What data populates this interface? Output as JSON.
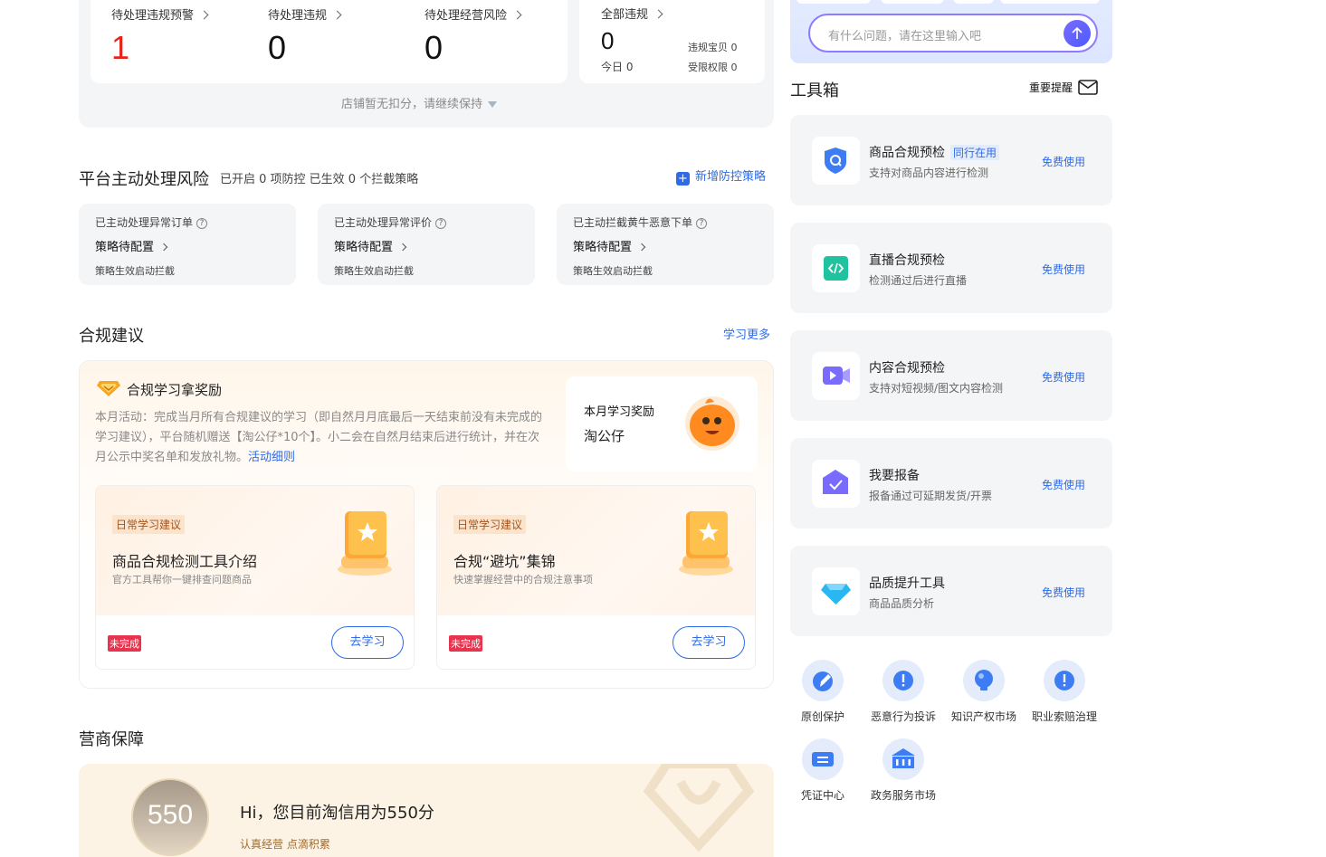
{
  "violations": {
    "items": [
      {
        "label": "待处理违规预警",
        "value": "1"
      },
      {
        "label": "待处理违规",
        "value": "0"
      },
      {
        "label": "待处理经营风险",
        "value": "0"
      }
    ],
    "all": {
      "label": "全部违规",
      "value": "0",
      "today": "今日 0",
      "stat1": "违规宝贝 0",
      "stat2": "受限权限 0"
    },
    "notice": "店铺暂无扣分，请继续保持"
  },
  "risk": {
    "title": "平台主动处理风险",
    "subtitle": "已开启 0 项防控 已生效 0 个拦截策略",
    "add_link": "新增防控策略",
    "cards": [
      {
        "title": "已主动处理异常订单",
        "status": "策略待配置",
        "note": "策略生效启动拦截"
      },
      {
        "title": "已主动处理异常评价",
        "status": "策略待配置",
        "note": "策略生效启动拦截"
      },
      {
        "title": "已主动拦截黄牛恶意下单",
        "status": "策略待配置",
        "note": "策略生效启动拦截"
      }
    ]
  },
  "compliance": {
    "title": "合规建议",
    "more": "学习更多",
    "reward_title": "合规学习拿奖励",
    "desc": "本月活动：完成当月所有合规建议的学习（即自然月月底最后一天结束前没有未完成的学习建议），平台随机赠送【淘公仔*10个】。小二会在自然月结束后进行统计，并在次月公示中奖名单和发放礼物。",
    "desc_link": "活动细则",
    "monthly": {
      "label": "本月学习奖励",
      "prize": "淘公仔"
    },
    "tasks": [
      {
        "tag": "日常学习建议",
        "title": "商品合规检测工具介绍",
        "sub": "官方工具帮你一键排查问题商品",
        "status": "未完成",
        "button": "去学习"
      },
      {
        "tag": "日常学习建议",
        "title": "合规“避坑”集锦",
        "sub": "快速掌握经营中的合规注意事项",
        "status": "未完成",
        "button": "去学习"
      }
    ]
  },
  "guarantee": {
    "title": "营商保障",
    "score": "550",
    "greeting": "Hi，您目前淘信用为550分",
    "slogan": "认真经营 点滴积累"
  },
  "chat": {
    "placeholder": "有什么问题，请在这里输入吧"
  },
  "toolbox": {
    "title": "工具箱",
    "reminder": "重要提醒",
    "tools": [
      {
        "name": "商品合规预检",
        "badge": "同行在用",
        "desc": "支持对商品内容进行检测",
        "action": "免费使用",
        "icon": "shield-search-icon"
      },
      {
        "name": "直播合规预检",
        "desc": "检测通过后进行直播",
        "action": "免费使用",
        "icon": "code-icon"
      },
      {
        "name": "内容合规预检",
        "desc": "支持对短视频/图文内容检测",
        "action": "免费使用",
        "icon": "video-icon"
      },
      {
        "name": "我要报备",
        "desc": "报备通过可延期发货/开票",
        "action": "免费使用",
        "icon": "check-house-icon"
      },
      {
        "name": "品质提升工具",
        "desc": "商品品质分析",
        "action": "免费使用",
        "icon": "diamond-icon"
      }
    ],
    "services": [
      {
        "label": "原创保护",
        "icon": "pen-icon"
      },
      {
        "label": "恶意行为投诉",
        "icon": "alert-icon"
      },
      {
        "label": "知识产权市场",
        "icon": "bulb-icon"
      },
      {
        "label": "职业索赔治理",
        "icon": "alert-icon"
      },
      {
        "label": "凭证中心",
        "icon": "ticket-icon"
      },
      {
        "label": "政务服务市场",
        "icon": "building-icon"
      }
    ]
  },
  "colors": {
    "accent": "#2c6bea",
    "alert": "#e8231a",
    "badge": "#e8334e",
    "purple": "#7a6bff"
  }
}
